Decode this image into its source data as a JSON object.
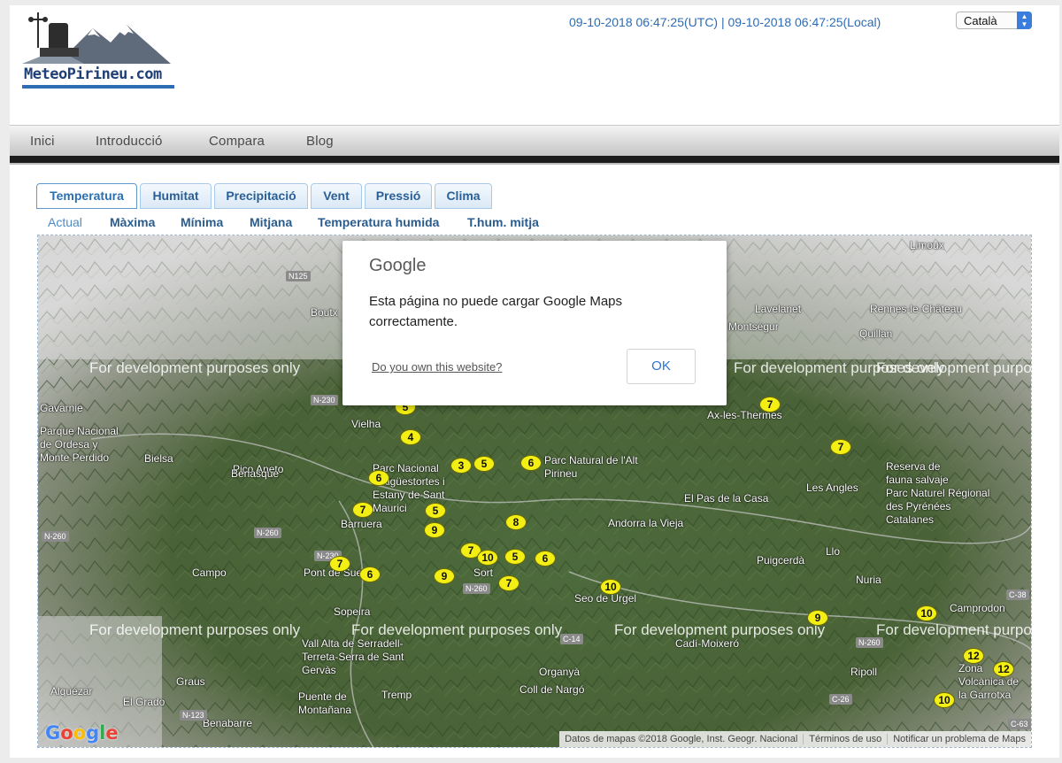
{
  "header": {
    "logo_text": "MeteoPirineu.com",
    "datetime": "09-10-2018 06:47:25(UTC) | 09-10-2018 06:47:25(Local)",
    "language": "Català"
  },
  "nav": {
    "items": [
      "Inici",
      "Introducció",
      "Compara",
      "Blog"
    ]
  },
  "tabs": [
    "Temperatura",
    "Humitat",
    "Precipitació",
    "Vent",
    "Pressió",
    "Clima"
  ],
  "active_tab": "Temperatura",
  "subtabs": [
    "Actual",
    "Màxima",
    "Mínima",
    "Mitjana",
    "Temperatura humida",
    "T.hum. mitja"
  ],
  "active_subtab": "Actual",
  "map": {
    "watermark": "For development purposes only",
    "places": [
      "Limoux",
      "Lavelanet",
      "Rennes-le-Château",
      "Montségur",
      "Quillan",
      "Boutx",
      "Gavarnie",
      "Parque Nacional de Ordesa y Monte Perdido",
      "Bielsa",
      "Pico Aneto",
      "Benasque",
      "Vielha",
      "Parc Nacional d'Aigüestortes i Estany de Sant Maurici",
      "Parc Natural de l'Alt Pirineu",
      "Ax-les-Thermes",
      "Les Angles",
      "Reserva de fauna salvaje",
      "Parc Naturel Régional des Pyrénées Catalanes",
      "Barruera",
      "El Pas de la Casa",
      "Andorra la Vieja",
      "Puigcerdà",
      "Llo",
      "Nuria",
      "Campo",
      "Pont de Suert",
      "Sort",
      "Seo de Urgel",
      "Cadí-Moixeró",
      "Sopeira",
      "Vall Alta de Serradell-Terreta-Serra de Sant Gervàs",
      "Graus",
      "Alquézar",
      "El Grado",
      "Puente de Montañana",
      "Benabarre",
      "Tremp",
      "Organyà",
      "Coll de Nargó",
      "Ripoll",
      "Camprodon",
      "Zona Volcànica de la Garrotxa"
    ],
    "roads": [
      "N125",
      "N-230",
      "N-260",
      "N-260",
      "N-230",
      "N-260",
      "C-14",
      "C-26",
      "N-260",
      "C-38",
      "C-63",
      "N-123"
    ],
    "markers": [
      "5",
      "6",
      "4",
      "3",
      "5",
      "6",
      "6",
      "7",
      "5",
      "9",
      "8",
      "7",
      "10",
      "5",
      "6",
      "7",
      "6",
      "9",
      "7",
      "10",
      "9",
      "10",
      "12",
      "12",
      "10",
      "7",
      "7"
    ],
    "google_logo": "Google",
    "attribution": [
      "Datos de mapas ©2018 Google, Inst. Geogr. Nacional",
      "Términos de uso",
      "Notificar un problema de Maps"
    ]
  },
  "dialog": {
    "brand": "Google",
    "message": "Esta página no puede cargar Google Maps correctamente.",
    "link": "Do you own this website?",
    "ok": "OK"
  }
}
